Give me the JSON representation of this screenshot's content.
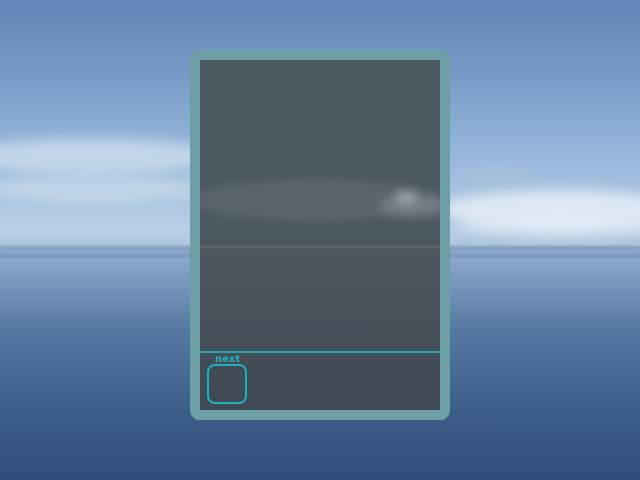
{
  "wallpaper": {
    "subject": "ocean-horizon",
    "sky_color": "#7398c4",
    "sea_color": "#3c5d88"
  },
  "panel": {
    "frame_color": "#6e9ea6",
    "accent_color": "#1fa7b4",
    "next_label": "next"
  }
}
